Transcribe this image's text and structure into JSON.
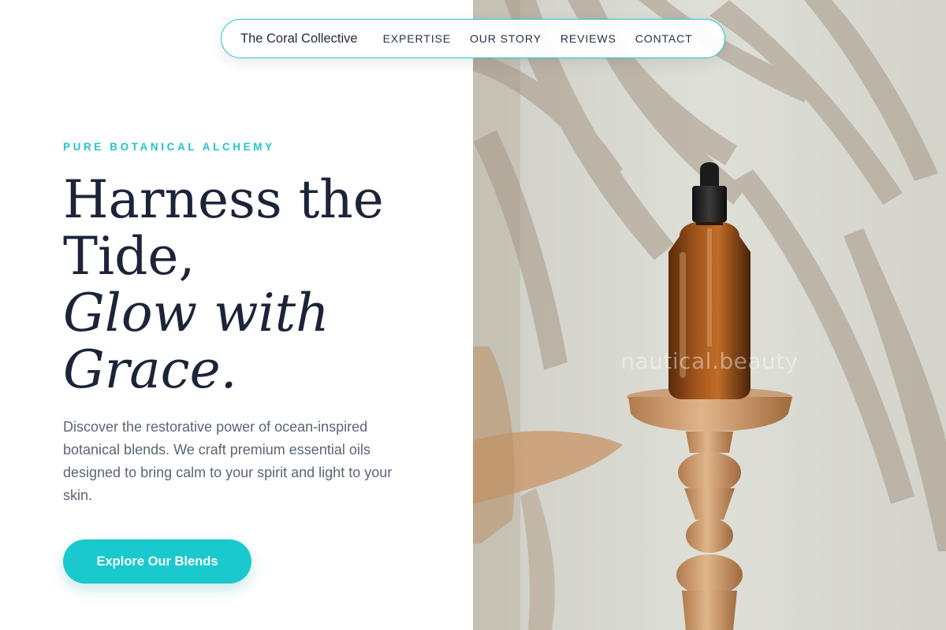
{
  "nav": {
    "brand": "The Coral Collective",
    "links": [
      {
        "label": "EXPERTISE"
      },
      {
        "label": "OUR STORY"
      },
      {
        "label": "REVIEWS"
      },
      {
        "label": "CONTACT"
      }
    ]
  },
  "hero": {
    "eyebrow": "PURE BOTANICAL ALCHEMY",
    "headline": {
      "line1": "Harness the",
      "line2": "Tide,",
      "line3": "Glow with",
      "line4": "Grace."
    },
    "description": "Discover the restorative power of ocean-inspired botanical blends. We craft premium essential oils designed to bring calm to your spirit and light to your skin.",
    "cta_label": "Explore Our Blends"
  },
  "image": {
    "watermark": "nautical.beauty"
  },
  "colors": {
    "accent": "#1ec6cc",
    "heading": "#1b2439",
    "body_text": "#5b6574",
    "nav_border": "#22c7cc"
  }
}
